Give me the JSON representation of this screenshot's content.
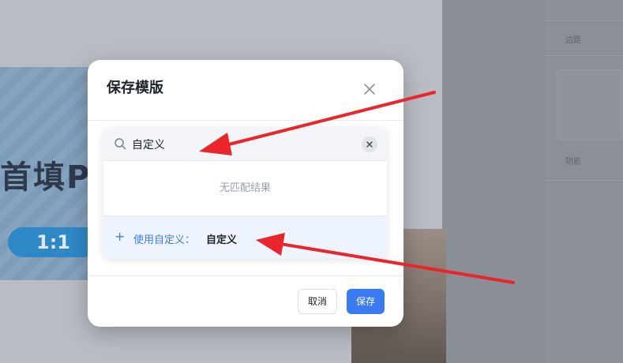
{
  "background": {
    "banner_text": "首填PC",
    "pill_text": "1:1",
    "right_label_1": "边距",
    "right_label_2": "阴影"
  },
  "dialog": {
    "title": "保存模版",
    "search": {
      "value": "自定义",
      "placeholder": ""
    },
    "no_result_text": "无匹配结果",
    "use_custom": {
      "label": "使用自定义：",
      "value": "自定义"
    },
    "buttons": {
      "cancel_label": "取消",
      "save_label": "保存"
    }
  },
  "colors": {
    "accent": "#3a7bf2",
    "annotation_arrow": "#e8262b"
  },
  "icons": {
    "close": "close-icon",
    "search": "search-icon",
    "clear": "clear-icon",
    "plus": "plus-icon"
  }
}
